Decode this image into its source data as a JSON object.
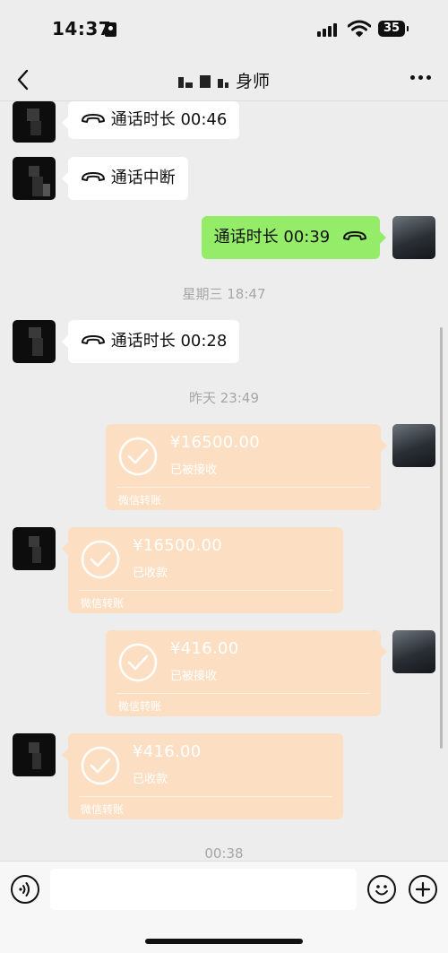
{
  "status_bar": {
    "time": "14:37",
    "battery": "35"
  },
  "nav": {
    "title": "身师",
    "back_icon": "chevron-left-icon",
    "more_icon": "ellipsis-icon"
  },
  "messages": {
    "call1": {
      "text": "通话时长 00:46"
    },
    "call2": {
      "text": "通话中断"
    },
    "call3": {
      "text": "通话时长 00:39"
    },
    "ts1": "星期三 18:47",
    "call4": {
      "text": "通话时长 00:28"
    },
    "ts2": "昨天 23:49",
    "transfer1": {
      "amount": "¥16500.00",
      "status": "已被接收",
      "footer": "微信转账"
    },
    "transfer2": {
      "amount": "¥16500.00",
      "status": "已收款",
      "footer": "微信转账"
    },
    "transfer3": {
      "amount": "¥416.00",
      "status": "已被接收",
      "footer": "微信转账"
    },
    "transfer4": {
      "amount": "¥416.00",
      "status": "已收款",
      "footer": "微信转账"
    },
    "ts3": "00:38"
  },
  "input_bar": {
    "placeholder": "",
    "voice_icon": "voice-icon",
    "emoji_icon": "emoji-icon",
    "plus_icon": "plus-icon"
  },
  "colors": {
    "background": "#ededed",
    "bubble_out": "#95ec69",
    "bubble_in": "#ffffff",
    "transfer": "#fcdfc3"
  }
}
